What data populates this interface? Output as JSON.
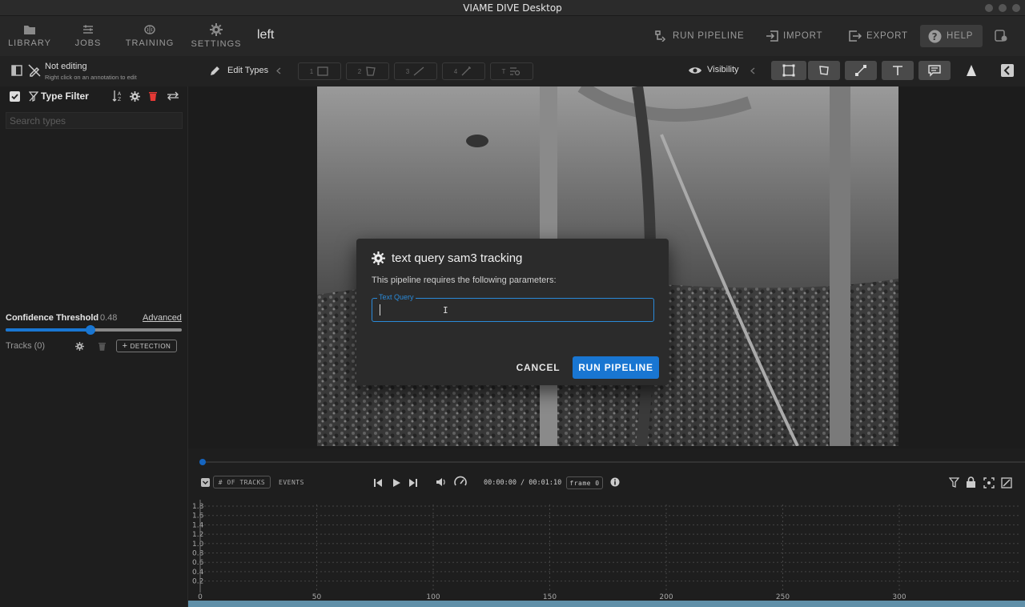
{
  "window": {
    "title": "VIAME DIVE Desktop"
  },
  "nav": {
    "items": [
      {
        "label": "LIBRARY",
        "icon": "folder-icon"
      },
      {
        "label": "JOBS",
        "icon": "tune-icon"
      },
      {
        "label": "TRAINING",
        "icon": "brain-icon"
      },
      {
        "label": "SETTINGS",
        "icon": "gear-icon"
      }
    ],
    "dataset_name": "left",
    "run_pipeline": "RUN PIPELINE",
    "import": "IMPORT",
    "export": "EXPORT",
    "help": "HELP"
  },
  "editbar": {
    "status_title": "Not editing",
    "status_hint": "Right click on an annotation to edit",
    "edit_types": "Edit Types",
    "visibility": "Visibility",
    "tools": [
      "1",
      "2",
      "3",
      "4",
      "T"
    ]
  },
  "left": {
    "type_filter": "Type Filter",
    "search_placeholder": "Search types",
    "confidence_label": "Confidence Threshold",
    "confidence_value": "0.48",
    "confidence_fraction": 0.48,
    "advanced": "Advanced",
    "tracks": "Tracks (0)",
    "detection_btn": "DETECTION"
  },
  "dialog": {
    "title": "text query sam3 tracking",
    "subtitle": "This pipeline requires the following parameters:",
    "field_label": "Text Query",
    "field_value": "",
    "cancel": "CANCEL",
    "run": "RUN PIPELINE"
  },
  "timeline": {
    "tracks_chip": "# OF TRACKS",
    "events": "EVENTS",
    "time": "00:00:00 / 00:01:10",
    "frame": "frame 0",
    "y_ticks": [
      "1.8",
      "1.6",
      "1.4",
      "1.2",
      "1.0",
      "0.8",
      "0.6",
      "0.4",
      "0.2"
    ],
    "x_ticks": [
      "0",
      "50",
      "100",
      "150",
      "200",
      "250",
      "300"
    ]
  },
  "colors": {
    "accent": "#1976d2",
    "field_focus": "#2a8ad9",
    "progress": "#1565c0"
  }
}
